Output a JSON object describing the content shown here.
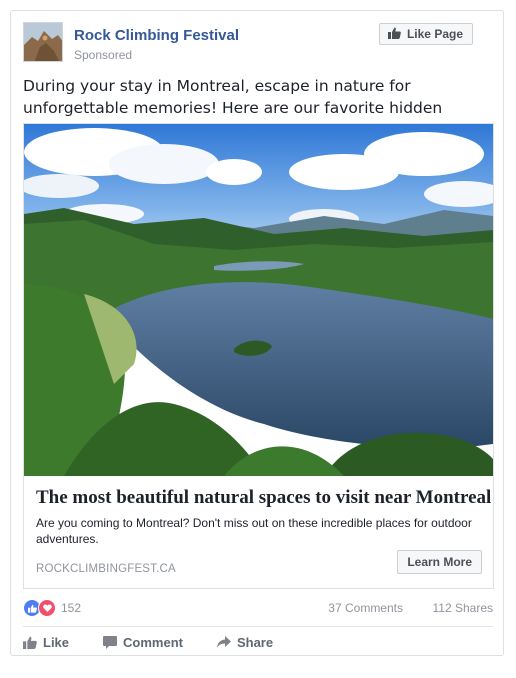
{
  "post": {
    "page_name": "Rock Climbing Festival",
    "sponsored_label": "Sponsored",
    "like_page_label": "Like Page",
    "text": "During your stay in Montreal, escape in nature for unforgettable memories! Here are our favorite hidden gems..."
  },
  "link": {
    "title": "The most beautiful natural spaces to visit near Montreal",
    "description": "Are you coming to Montreal? Don't miss out on these incredible places for outdoor adventures.",
    "domain": "ROCKCLIMBINGFEST.CA",
    "cta_label": "Learn More"
  },
  "engagement": {
    "reaction_count": "152",
    "comments": "37 Comments",
    "shares": "112 Shares"
  },
  "actions": {
    "like": "Like",
    "comment": "Comment",
    "share": "Share"
  },
  "colors": {
    "link_blue": "#365899",
    "muted_gray": "#90949c",
    "like_reaction": "#4f7ef3",
    "love_reaction": "#f0506e"
  },
  "icons": [
    "page-avatar",
    "thumbs-up-icon",
    "heart-icon",
    "comment-icon",
    "share-icon"
  ]
}
